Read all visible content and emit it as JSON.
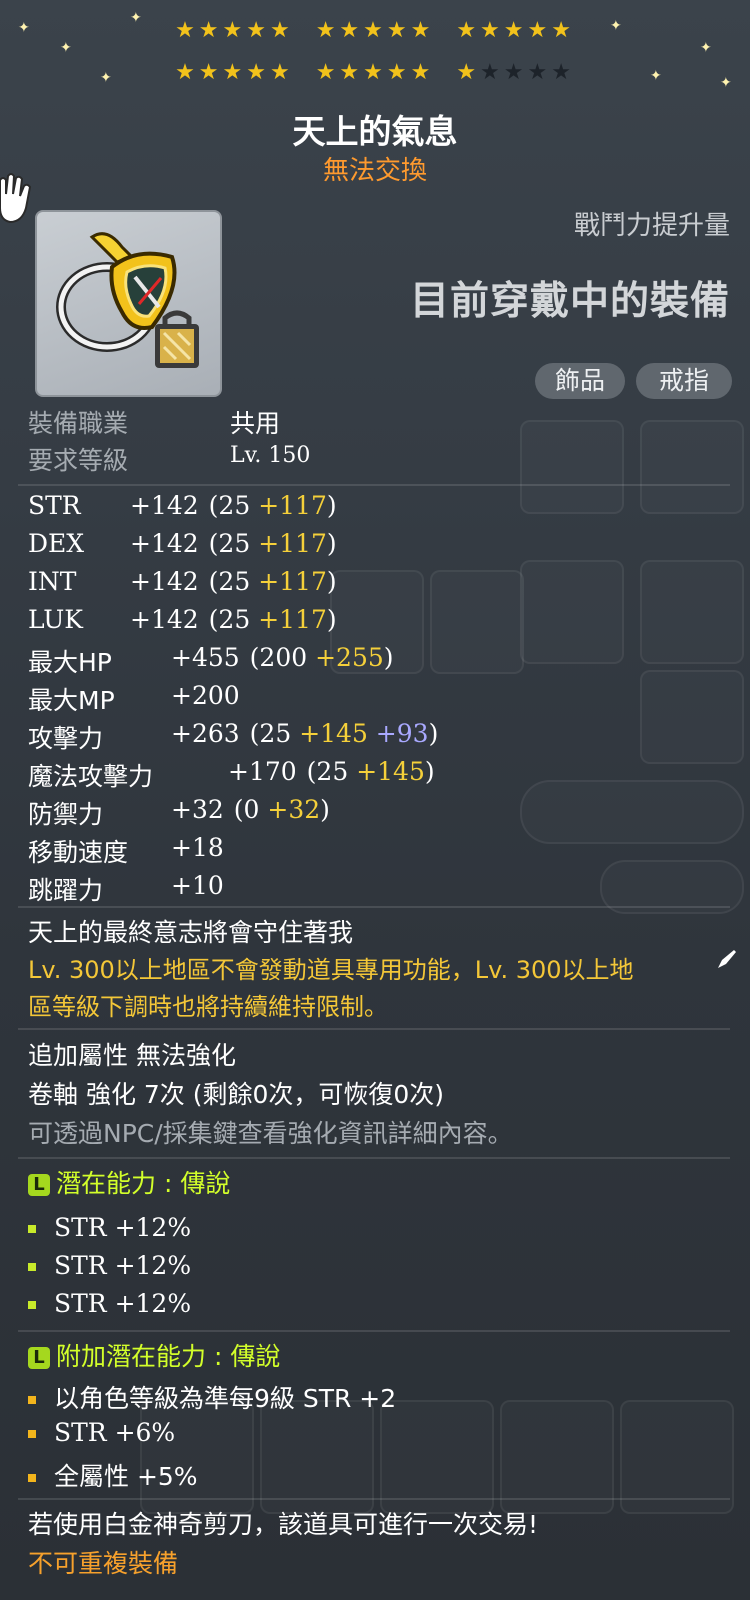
{
  "stars": {
    "row1_filled": 15,
    "row2_filled": 11,
    "row2_empty": 4
  },
  "item": {
    "name": "天上的氣息",
    "trade_status": "無法交換",
    "icon_name": "ring-icon"
  },
  "combat_power": {
    "label": "戰鬥力提升量",
    "compare_text": "目前穿戴中的裝備"
  },
  "tags": [
    "飾品",
    "戒指"
  ],
  "requirements": [
    {
      "label": "裝備職業",
      "value": "共用"
    },
    {
      "label": "要求等級",
      "value": "Lv. 150"
    }
  ],
  "stats": [
    {
      "name": "STR",
      "total": "+142",
      "base": "(25 ",
      "bonus": "+117",
      "extra": "",
      "close": ")"
    },
    {
      "name": "DEX",
      "total": "+142",
      "base": "(25 ",
      "bonus": "+117",
      "extra": "",
      "close": ")"
    },
    {
      "name": "INT",
      "total": "+142",
      "base": "(25 ",
      "bonus": "+117",
      "extra": "",
      "close": ")"
    },
    {
      "name": "LUK",
      "total": "+142",
      "base": "(25 ",
      "bonus": "+117",
      "extra": "",
      "close": ")"
    },
    {
      "name": "最大HP",
      "total": "+455",
      "base": "(200 ",
      "bonus": "+255",
      "extra": "",
      "close": ")"
    },
    {
      "name": "最大MP",
      "total": "+200",
      "base": "",
      "bonus": "",
      "extra": "",
      "close": ""
    },
    {
      "name": "攻擊力",
      "total": "+263",
      "base": "(25 ",
      "bonus": "+145",
      "extra": " +93",
      "close": ")"
    },
    {
      "name": "魔法攻擊力",
      "total": "+170",
      "base": "(25 ",
      "bonus": "+145",
      "extra": "",
      "close": ")"
    },
    {
      "name": "防禦力",
      "total": "+32",
      "base": "(0 ",
      "bonus": "+32",
      "extra": "",
      "close": ")"
    },
    {
      "name": "移動速度",
      "total": "+18",
      "base": "",
      "bonus": "",
      "extra": "",
      "close": ""
    },
    {
      "name": "跳躍力",
      "total": "+10",
      "base": "",
      "bonus": "",
      "extra": "",
      "close": ""
    }
  ],
  "description": "天上的最終意志將會守住著我",
  "warning": {
    "line1": "Lv. 300以上地區不會發動道具專用功能，Lv. 300以上地",
    "line2": "區等級下調時也將持續維持限制。"
  },
  "enhance": {
    "flame": "追加屬性 無法強化",
    "scroll": "卷軸 強化 7次 (剩餘0次，可恢復0次)",
    "hint": "可透過NPC/採集鍵查看強化資訊詳細內容。"
  },
  "potential": {
    "tag": "L",
    "title": "潛在能力 : 傳說",
    "lines": [
      "STR +12%",
      "STR +12%",
      "STR +12%"
    ]
  },
  "bonus_potential": {
    "tag": "L",
    "title": "附加潛在能力 : 傳說",
    "lines": [
      "以角色等級為準每9級 STR +2",
      "STR +6%",
      "全屬性 +5%"
    ]
  },
  "footer": {
    "trade_note": "若使用白金神奇剪刀，該道具可進行一次交易!",
    "unique": "不可重複裝備"
  },
  "colors": {
    "bonus": "#f5d03a",
    "star_bonus": "#a9a9ff",
    "legendary": "#d3ff2a",
    "warning": "#f4c738",
    "untradeable": "#ff9a2e"
  }
}
